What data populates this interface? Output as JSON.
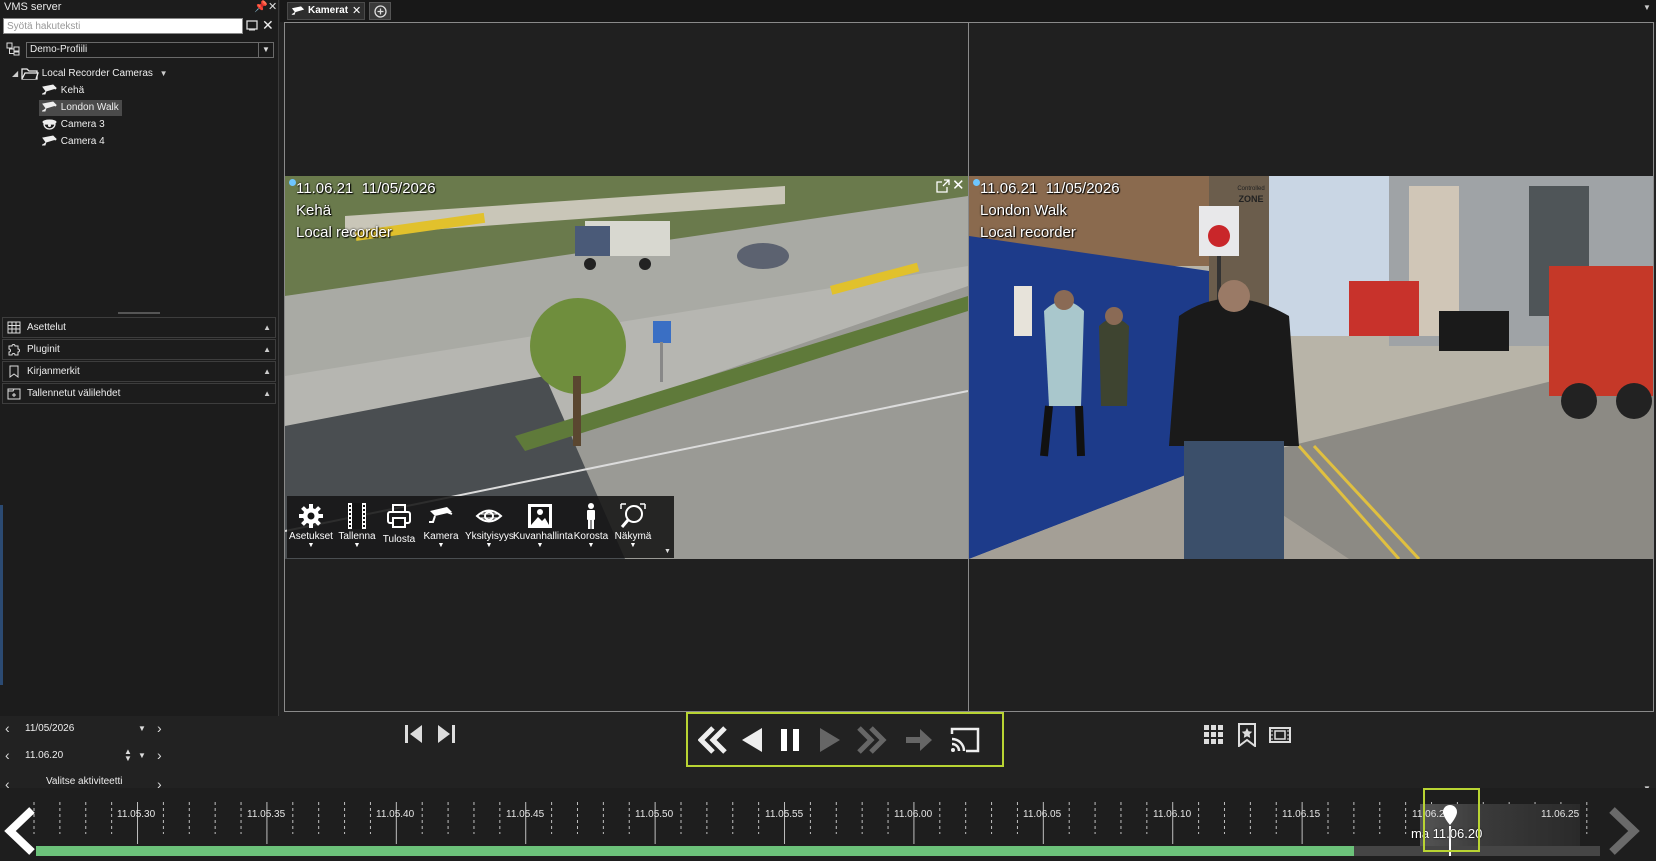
{
  "panel": {
    "title": "VMS server",
    "search_placeholder": "Syötä hakuteksti",
    "profile": "Demo-Profiili",
    "tree": {
      "root": "Local Recorder Cameras",
      "cameras": [
        "Kehä",
        "London Walk",
        "Camera 3",
        "Camera 4"
      ],
      "selected": "London Walk"
    },
    "sections": [
      "Asettelut",
      "Pluginit",
      "Kirjanmerkit",
      "Tallennetut välilehdet"
    ]
  },
  "tabs": {
    "active": "Kamerat"
  },
  "feeds": {
    "left": {
      "time": "11.06.21",
      "date": "11/05/2026",
      "name": "Kehä",
      "source": "Local recorder"
    },
    "right": {
      "time": "11.06.21",
      "date": "11/05/2026",
      "name": "London Walk",
      "source": "Local recorder"
    },
    "signs": {
      "zone_top": "Controlled",
      "zone_main": "ZONE"
    }
  },
  "camera_toolbar": [
    "Asetukset",
    "Tallenna",
    "Tulosta",
    "Kamera",
    "Yksityisyys",
    "Kuvanhallinta",
    "Korosta",
    "Näkymä"
  ],
  "controls": {
    "date": "11/05/2026",
    "time": "11.06.20",
    "activity_label": "Valitse aktiviteetti"
  },
  "timeline": {
    "ticks": [
      "11.05.30",
      "11.05.35",
      "11.05.40",
      "11.05.45",
      "11.05.50",
      "11.05.55",
      "11.06.00",
      "11.06.05",
      "11.06.10",
      "11.06.15",
      "11.06.2",
      "11.06.25"
    ],
    "cursor_label": "ma 11.06.20"
  },
  "colors": {
    "highlight": "#b9d433",
    "recorded": "#6cc27a",
    "live_dot": "#6ec6ff"
  }
}
